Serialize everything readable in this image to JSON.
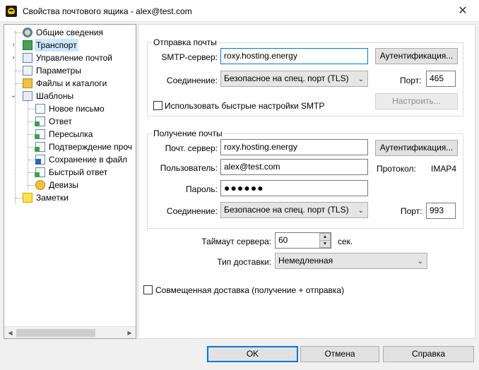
{
  "window": {
    "title": "Свойства почтового ящика - alex@test.com",
    "close_glyph": "✕"
  },
  "tree": {
    "items": [
      {
        "label": "Общие сведения",
        "icon": "person-card-icon"
      },
      {
        "label": "Транспорт",
        "icon": "transport-icon"
      },
      {
        "label": "Управление почтой",
        "icon": "mail-management-icon"
      },
      {
        "label": "Параметры",
        "icon": "parameters-icon"
      },
      {
        "label": "Файлы и каталоги",
        "icon": "folder-icon"
      },
      {
        "label": "Шаблоны",
        "icon": "templates-icon"
      },
      {
        "label": "Новое письмо",
        "icon": "document-icon"
      },
      {
        "label": "Ответ",
        "icon": "reply-icon"
      },
      {
        "label": "Пересылка",
        "icon": "forward-icon"
      },
      {
        "label": "Подтверждение проч",
        "icon": "confirmation-icon"
      },
      {
        "label": "Сохранение в файл",
        "icon": "save-icon"
      },
      {
        "label": "Быстрый ответ",
        "icon": "quick-reply-icon"
      },
      {
        "label": "Девизы",
        "icon": "coins-icon"
      },
      {
        "label": "Заметки",
        "icon": "notes-icon"
      }
    ],
    "collapsed_glyph": "›",
    "expanded_glyph": "⌄",
    "scroll_left": "◀",
    "scroll_right": "▶"
  },
  "send": {
    "legend": "Отправка почты",
    "smtp_label": "SMTP-сервер:",
    "smtp_value": "roxy.hosting.energy",
    "auth_button": "Аутентификация...",
    "connection_label": "Соединение:",
    "connection_value": "Безопасное на спец. порт (TLS)",
    "port_label": "Порт:",
    "port_value": "465",
    "quick_settings_label": "Использовать быстрые настройки SMTP",
    "configure_button": "Настроить..."
  },
  "receive": {
    "legend": "Получение почты",
    "server_label": "Почт. сервер:",
    "server_value": "roxy.hosting.energy",
    "auth_button": "Аутентификация...",
    "user_label": "Пользователь:",
    "user_value": "alex@test.com",
    "protocol_label": "Протокол:",
    "protocol_value": "IMAP4",
    "password_label": "Пароль:",
    "password_value": "●●●●●●",
    "connection_label": "Соединение:",
    "connection_value": "Безопасное на спец. порт (TLS)",
    "port_label": "Порт:",
    "port_value": "993"
  },
  "timeout": {
    "label": "Таймаут сервера:",
    "value": "60",
    "unit": "сек.",
    "up": "▲",
    "down": "▼"
  },
  "delivery": {
    "label": "Тип доставки:",
    "value": "Немедленная"
  },
  "combined": {
    "label": "Совмещенная доставка (получение + отправка)"
  },
  "caret": "⌄",
  "buttons": {
    "ok": "OK",
    "cancel": "Отмена",
    "help": "Справка"
  }
}
